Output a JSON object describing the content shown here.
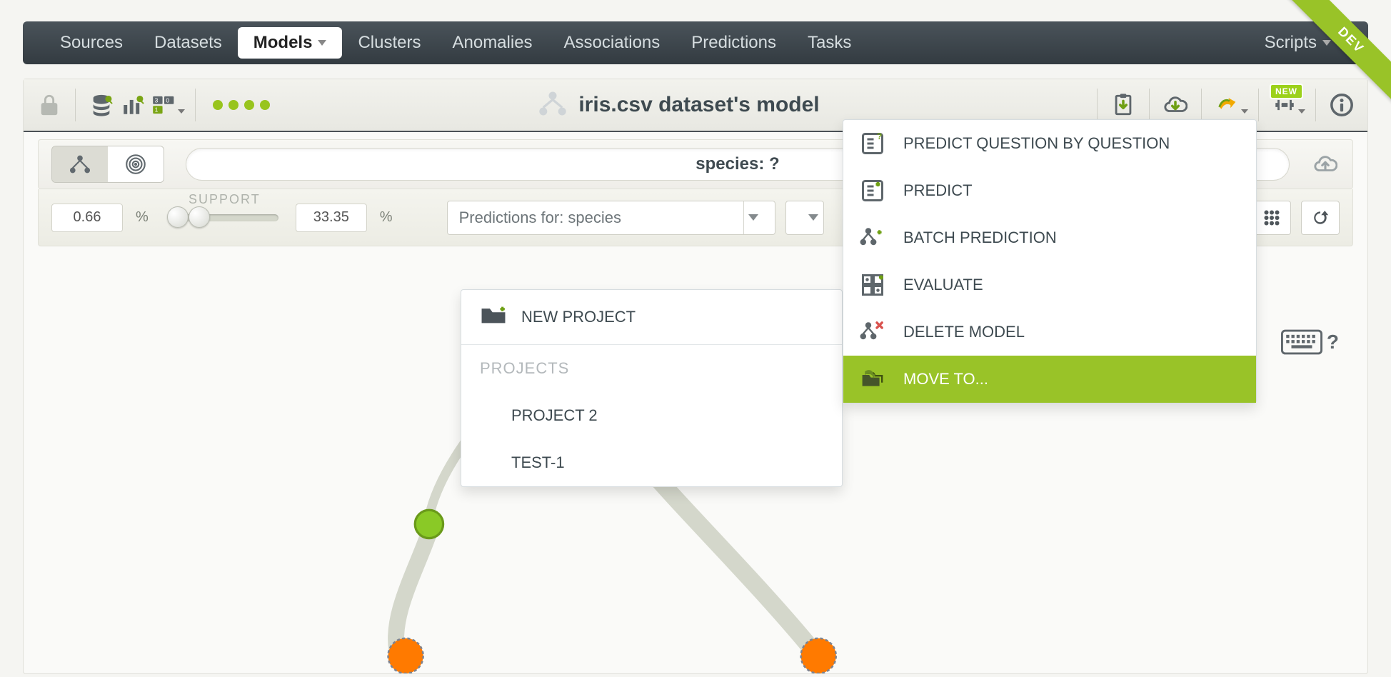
{
  "nav": {
    "items": [
      "Sources",
      "Datasets",
      "Models",
      "Clusters",
      "Anomalies",
      "Associations",
      "Predictions",
      "Tasks"
    ],
    "active_index": 2,
    "right_item": "Scripts"
  },
  "ribbon": {
    "label": "DEV"
  },
  "titlebar": {
    "title": "iris.csv dataset's model",
    "new_badge": "NEW"
  },
  "bar2": {
    "species_label": "species: ?"
  },
  "bar3": {
    "support_label": "SUPPORT",
    "support_min": "0.66",
    "support_max": "33.35",
    "predictions_dropdown": "Predictions for: species"
  },
  "actions_menu": {
    "items": [
      {
        "label": "PREDICT QUESTION BY QUESTION",
        "icon": "predict-q-icon"
      },
      {
        "label": "PREDICT",
        "icon": "predict-icon"
      },
      {
        "label": "BATCH PREDICTION",
        "icon": "batch-icon"
      },
      {
        "label": "EVALUATE",
        "icon": "evaluate-icon"
      },
      {
        "label": "DELETE MODEL",
        "icon": "delete-icon"
      },
      {
        "label": "MOVE TO...",
        "icon": "move-icon",
        "highlight": true
      }
    ]
  },
  "projects_menu": {
    "new_project": "NEW PROJECT",
    "section": "PROJECTS",
    "items": [
      "PROJECT 2",
      "TEST-1"
    ]
  }
}
